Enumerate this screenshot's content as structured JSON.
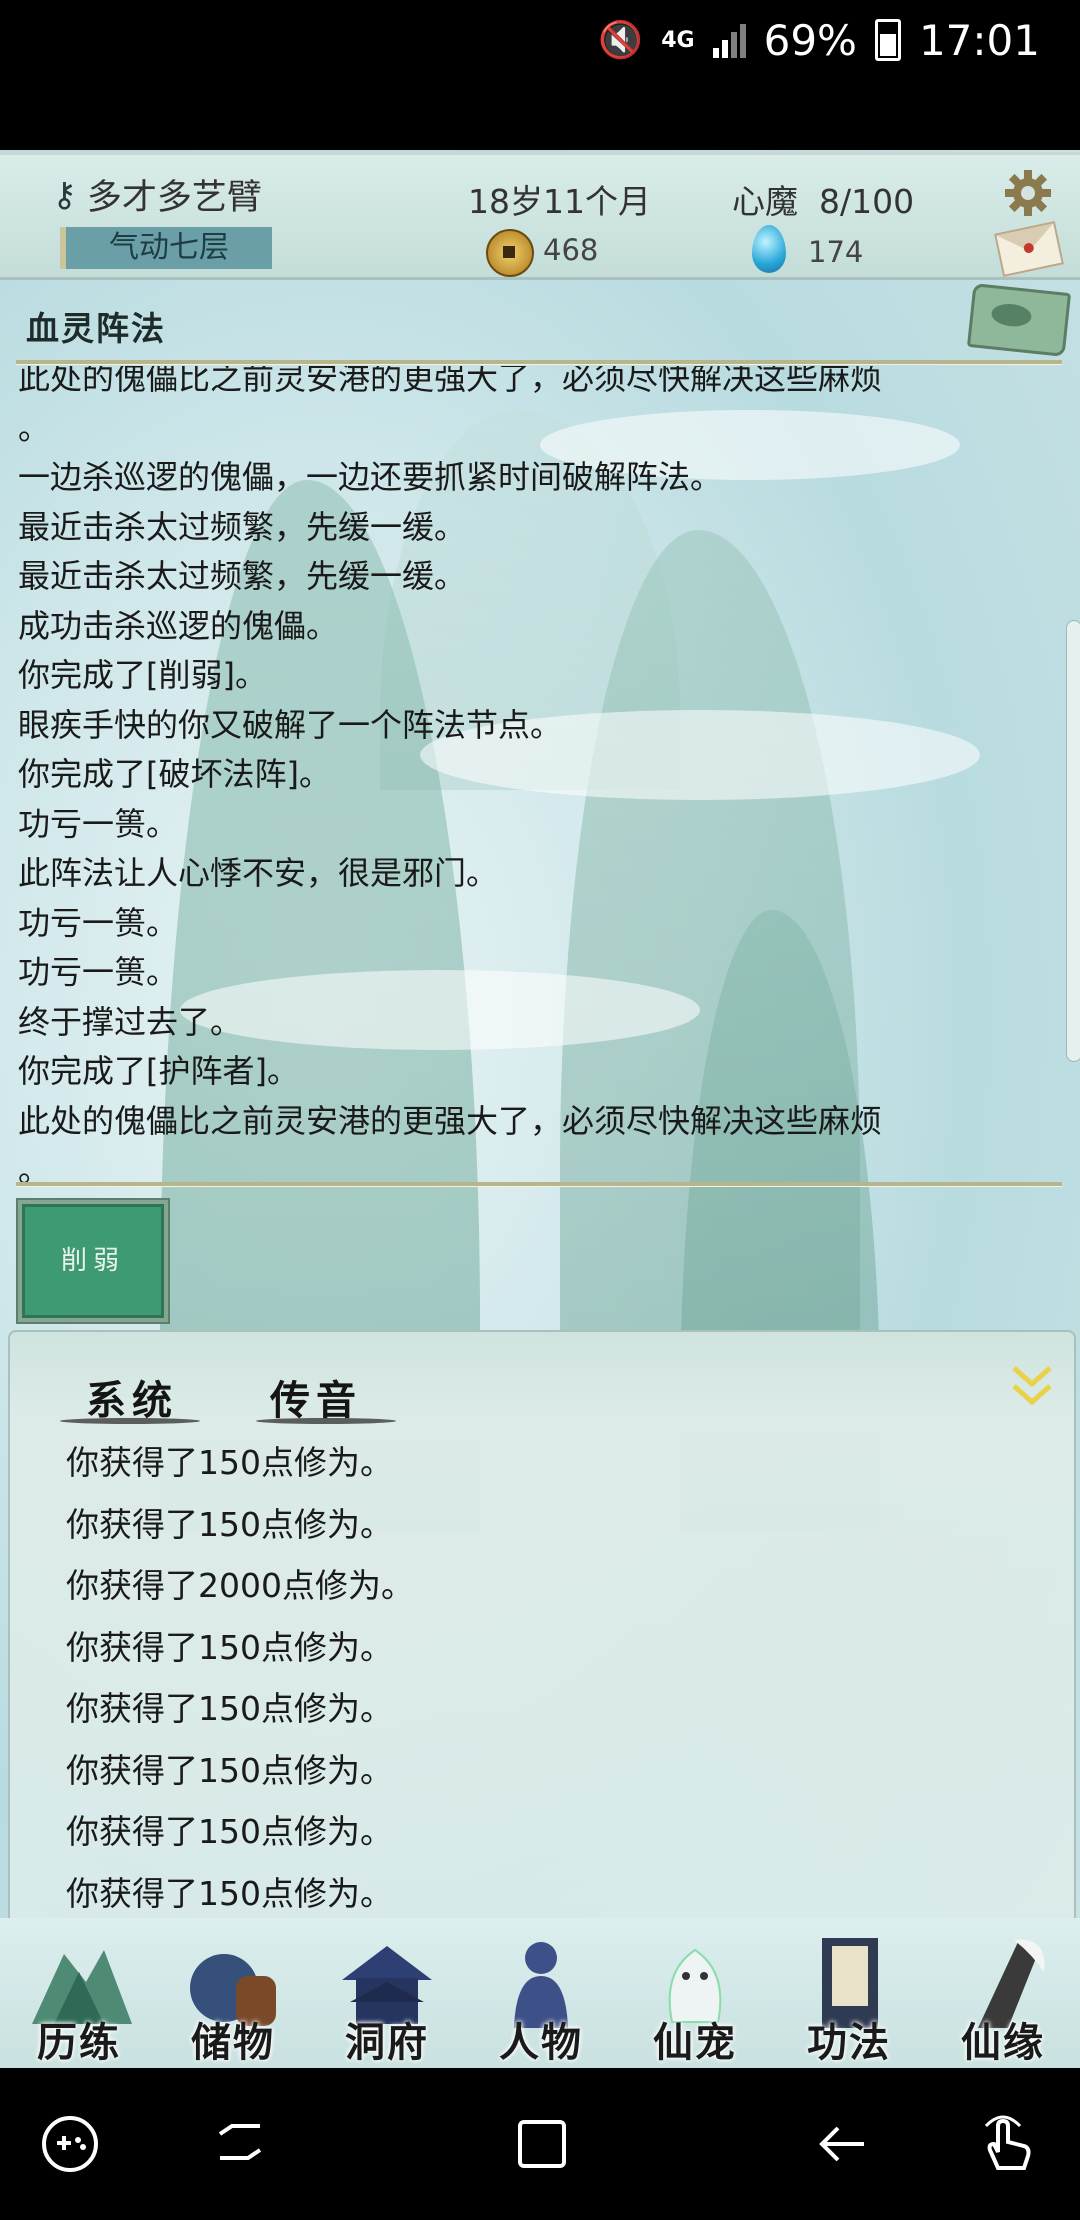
{
  "status_bar": {
    "network": "4G",
    "battery": "69%",
    "time": "17:01"
  },
  "player": {
    "name": "多才多艺臂",
    "realm": "气动七层",
    "age": "18岁11个月",
    "heart_demon": "心魔  8/100",
    "coins": "468",
    "spirit_stones": "174"
  },
  "panel": {
    "title": "血灵阵法",
    "log": [
      "此处的傀儡比之前灵安港的更强大了，必须尽快解决这些麻烦",
      "。",
      "一边杀巡逻的傀儡，一边还要抓紧时间破解阵法。",
      "最近击杀太过频繁，先缓一缓。",
      "最近击杀太过频繁，先缓一缓。",
      "成功击杀巡逻的傀儡。",
      "你完成了[削弱]。",
      "眼疾手快的你又破解了一个阵法节点。",
      "你完成了[破坏法阵]。",
      "功亏一篑。",
      "此阵法让人心悸不安，很是邪门。",
      "功亏一篑。",
      "功亏一篑。",
      "终于撑过去了。",
      "你完成了[护阵者]。",
      "此处的傀儡比之前灵安港的更强大了，必须尽快解决这些麻烦",
      "。"
    ],
    "action_button": "削弱"
  },
  "chat": {
    "tabs": [
      "系统",
      "传音"
    ],
    "messages": [
      "你获得了150点修为。",
      "你获得了150点修为。",
      "你获得了2000点修为。",
      "你获得了150点修为。",
      "你获得了150点修为。",
      "你获得了150点修为。",
      "你获得了150点修为。",
      "你获得了150点修为。"
    ]
  },
  "nav": [
    "历练",
    "储物",
    "洞府",
    "人物",
    "仙宠",
    "功法",
    "仙缘"
  ],
  "icons": {
    "status": [
      "mute-icon",
      "signal-icon",
      "battery-icon"
    ],
    "system_nav": [
      "game-tools-icon",
      "recents-icon",
      "home-icon",
      "back-icon",
      "gesture-icon"
    ]
  },
  "colors": {
    "realm_bg": "#6b9fa8",
    "action_button": "#3d9a72",
    "rule": "#b7b58b"
  }
}
